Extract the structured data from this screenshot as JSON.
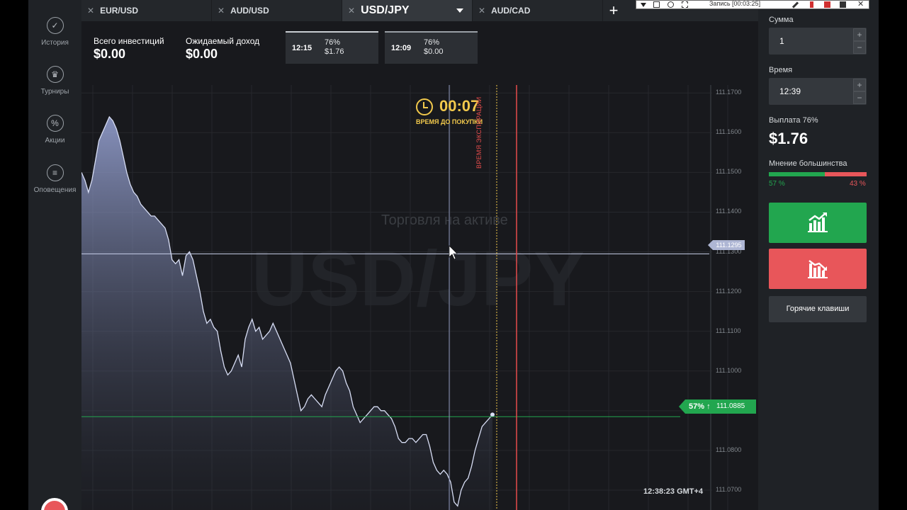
{
  "nav": {
    "items": [
      {
        "label": "История",
        "icon": "check-icon"
      },
      {
        "label": "Турниры",
        "icon": "trophy-icon"
      },
      {
        "label": "Акции",
        "icon": "percent-icon"
      },
      {
        "label": "Оповещения",
        "icon": "list-icon"
      }
    ]
  },
  "tabs": [
    {
      "label": "EUR/USD",
      "active": false
    },
    {
      "label": "AUD/USD",
      "active": false
    },
    {
      "label": "USD/JPY",
      "active": true
    },
    {
      "label": "AUD/CAD",
      "active": false
    }
  ],
  "tab_add": "+",
  "stats": {
    "invested_label": "Всего инвестиций",
    "invested_value": "$0.00",
    "expected_label": "Ожидаемый доход",
    "expected_value": "$0.00"
  },
  "deals": [
    {
      "time": "12:15",
      "percent": "76%",
      "payout": "$1.76",
      "accent": "#c9cdd2"
    },
    {
      "time": "12:09",
      "percent": "76%",
      "payout": "$0.00",
      "accent": "#9aa0a6"
    }
  ],
  "chart": {
    "asset": "USD/JPY",
    "trading_on_asset": "Торговля на активе",
    "timer_value": "00:07",
    "timer_caption": "ВРЕМЯ ДО ПОКУПКИ",
    "expiration_caption": "ВРЕМЯ ЭКСПИРАЦИИ",
    "current_price": "111.1295",
    "opinion_percent": "57% ↑",
    "opinion_price": "111.0885",
    "clock": "12:38:23 GMT+4",
    "y_ticks": [
      "111.1700",
      "111.1600",
      "111.1500",
      "111.1400",
      "111.1300",
      "111.1200",
      "111.1100",
      "111.1000",
      "111.0900",
      "111.0800",
      "111.0700"
    ]
  },
  "chart_data": {
    "type": "area",
    "title": "",
    "xlabel": "",
    "ylabel": "",
    "ylim": [
      111.065,
      111.172
    ],
    "series": [
      {
        "values": [
          111.15,
          111.148,
          111.145,
          111.148,
          111.153,
          111.158,
          111.16,
          111.162,
          111.164,
          111.163,
          111.161,
          111.158,
          111.154,
          111.15,
          111.147,
          111.145,
          111.144,
          111.142,
          111.141,
          111.14,
          111.139,
          111.139,
          111.138,
          111.137,
          111.136,
          111.133,
          111.128,
          111.127,
          111.128,
          111.124,
          111.129,
          111.13,
          111.128,
          111.124,
          111.12,
          111.115,
          111.112,
          111.113,
          111.111,
          111.11,
          111.105,
          111.101,
          111.099,
          111.1,
          111.102,
          111.104,
          111.101,
          111.108,
          111.111,
          111.113,
          111.11,
          111.111,
          111.108,
          111.109,
          111.11,
          111.112,
          111.11,
          111.108,
          111.106,
          111.104,
          111.102,
          111.098,
          111.094,
          111.09,
          111.091,
          111.093,
          111.094,
          111.093,
          111.092,
          111.091,
          111.094,
          111.096,
          111.098,
          111.1,
          111.101,
          111.1,
          111.097,
          111.095,
          111.091,
          111.089,
          111.087,
          111.088,
          111.089,
          111.09,
          111.091,
          111.091,
          111.09,
          111.09,
          111.089,
          111.088,
          111.086,
          111.083,
          111.082,
          111.082,
          111.083,
          111.083,
          111.082,
          111.083,
          111.084,
          111.084,
          111.081,
          111.077,
          111.075,
          111.074,
          111.075,
          111.074,
          111.072,
          111.067,
          111.066,
          111.07,
          111.072,
          111.073,
          111.076,
          111.08,
          111.083,
          111.086,
          111.087,
          111.088,
          111.089
        ]
      }
    ]
  },
  "panel": {
    "amount_label": "Сумма",
    "amount_value": "1",
    "time_label": "Время",
    "time_value": "12:39",
    "stepper_plus": "+",
    "stepper_minus": "−",
    "payout_label": "Выплата 76%",
    "payout_value": "$1.76",
    "majority_label": "Мнение большинства",
    "majority_up": "57 %",
    "majority_down": "43 %",
    "majority_up_fraction": 0.57,
    "hotkeys_label": "Горячие клавиши",
    "up_color": "#22a64f",
    "down_color": "#e8565a"
  },
  "recorder": {
    "title": "Запись [00:03:25]"
  }
}
